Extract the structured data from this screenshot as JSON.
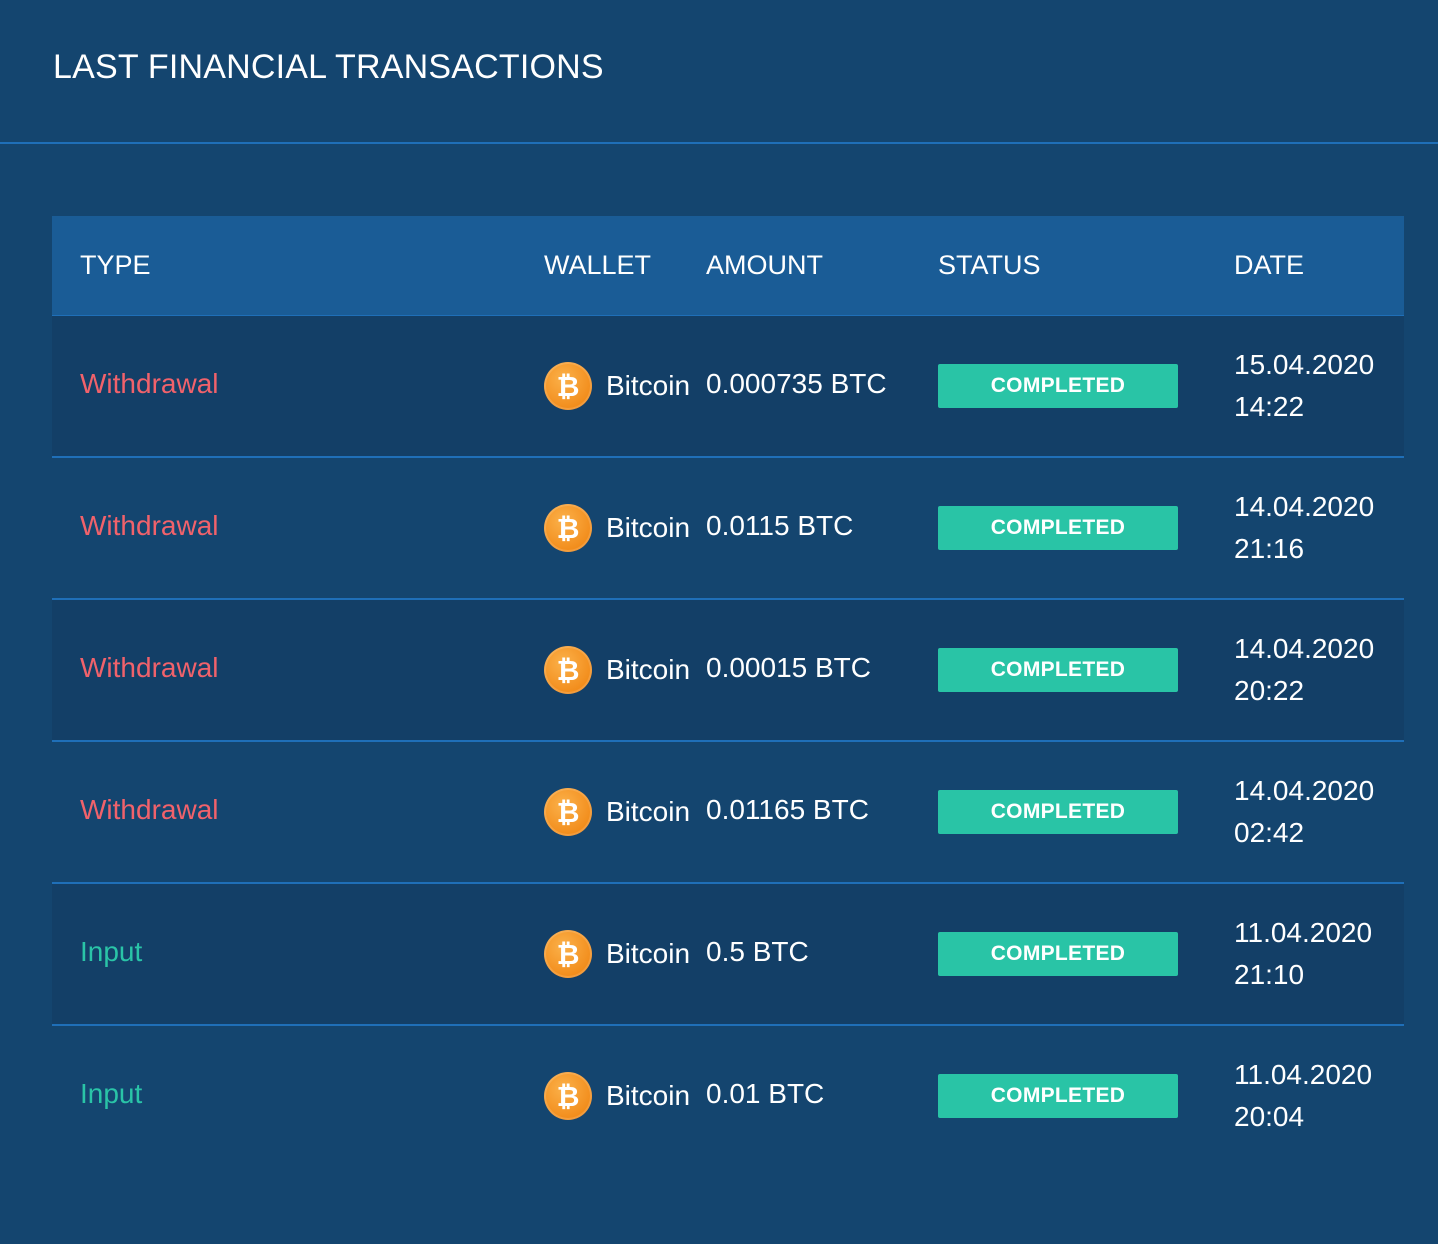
{
  "title": "LAST FINANCIAL TRANSACTIONS",
  "columns": {
    "type": "TYPE",
    "wallet": "WALLET",
    "amount": "AMOUNT",
    "status": "STATUS",
    "date": "DATE"
  },
  "colors": {
    "background": "#14456f",
    "header_background": "#1a5c96",
    "divider": "#1f6fb8",
    "withdrawal": "#f1626b",
    "input": "#2ac4a7",
    "status_badge": "#29c4a6",
    "bitcoin": "#f28d1c"
  },
  "rows": [
    {
      "type": "Withdrawal",
      "type_kind": "withdrawal",
      "wallet_icon": "bitcoin-icon",
      "wallet": "Bitcoin",
      "amount": "0.000735 BTC",
      "status": "COMPLETED",
      "date": "15.04.2020",
      "time": "14:22"
    },
    {
      "type": "Withdrawal",
      "type_kind": "withdrawal",
      "wallet_icon": "bitcoin-icon",
      "wallet": "Bitcoin",
      "amount": "0.0115 BTC",
      "status": "COMPLETED",
      "date": "14.04.2020",
      "time": "21:16"
    },
    {
      "type": "Withdrawal",
      "type_kind": "withdrawal",
      "wallet_icon": "bitcoin-icon",
      "wallet": "Bitcoin",
      "amount": "0.00015 BTC",
      "status": "COMPLETED",
      "date": "14.04.2020",
      "time": "20:22"
    },
    {
      "type": "Withdrawal",
      "type_kind": "withdrawal",
      "wallet_icon": "bitcoin-icon",
      "wallet": "Bitcoin",
      "amount": "0.01165 BTC",
      "status": "COMPLETED",
      "date": "14.04.2020",
      "time": "02:42"
    },
    {
      "type": "Input",
      "type_kind": "input",
      "wallet_icon": "bitcoin-icon",
      "wallet": "Bitcoin",
      "amount": "0.5 BTC",
      "status": "COMPLETED",
      "date": "11.04.2020",
      "time": "21:10"
    },
    {
      "type": "Input",
      "type_kind": "input",
      "wallet_icon": "bitcoin-icon",
      "wallet": "Bitcoin",
      "amount": "0.01 BTC",
      "status": "COMPLETED",
      "date": "11.04.2020",
      "time": "20:04"
    }
  ]
}
